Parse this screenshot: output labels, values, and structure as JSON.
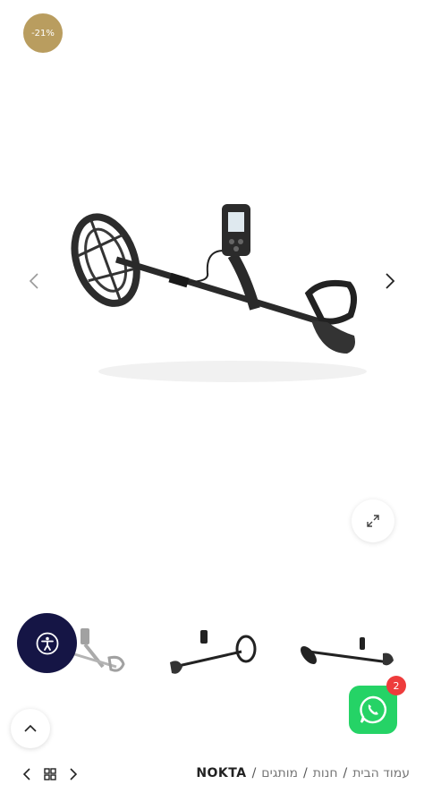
{
  "badge": {
    "discount": "-21%"
  },
  "colors": {
    "badge": "#b99d5f",
    "accessibility": "#151545",
    "whatsapp": "#25d366",
    "notification": "#ee3c3c"
  },
  "gallery": {
    "icons": {
      "prev": "chevron-left-icon",
      "next": "chevron-right-icon",
      "zoom": "expand-icon"
    }
  },
  "whatsapp": {
    "count": "2"
  },
  "breadcrumb": {
    "items": [
      "עמוד הבית",
      "חנות",
      "מותגים"
    ],
    "separator": "/",
    "current": "NOKTA"
  }
}
